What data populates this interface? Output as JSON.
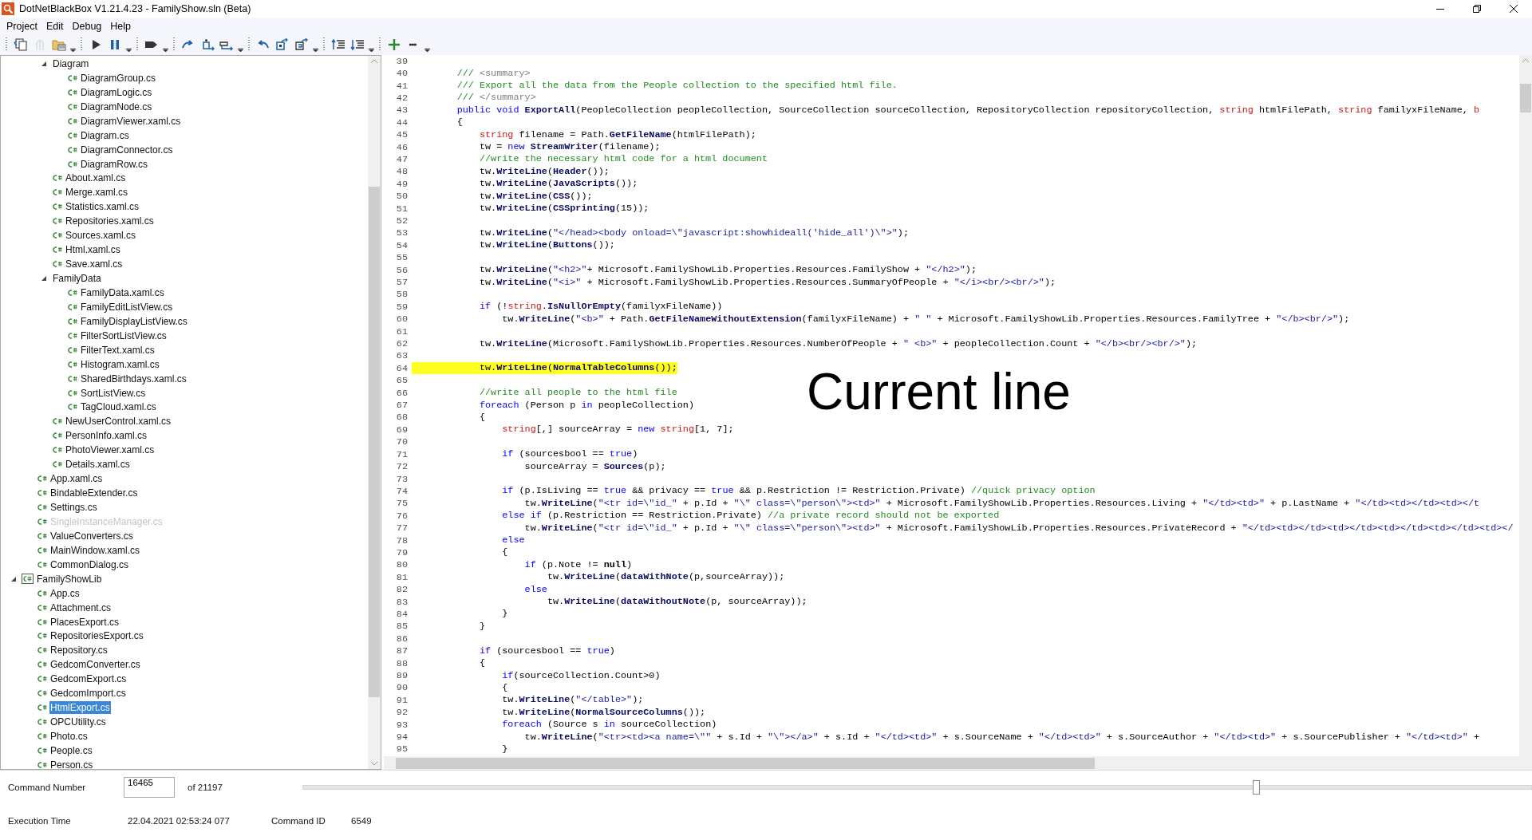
{
  "window": {
    "title": "DotNetBlackBox V1.21.4.23 - FamilyShow.sln (Beta)"
  },
  "menu": [
    "Project",
    "Edit",
    "Debug",
    "Help"
  ],
  "tree": {
    "items": [
      {
        "children": [
          {
            "children": [
              {
                "kind": "folder",
                "label": "Diagram",
                "expanded": true,
                "children": [
                  {
                    "kind": "file",
                    "label": "DiagramGroup.cs",
                    "disabled": false,
                    "selected": false
                  },
                  {
                    "kind": "file",
                    "label": "DiagramLogic.cs",
                    "disabled": false,
                    "selected": false
                  },
                  {
                    "kind": "file",
                    "label": "DiagramNode.cs",
                    "disabled": false,
                    "selected": false
                  },
                  {
                    "kind": "file",
                    "label": "DiagramViewer.xaml.cs",
                    "disabled": false,
                    "selected": false
                  },
                  {
                    "kind": "file",
                    "label": "Diagram.cs",
                    "disabled": false,
                    "selected": false
                  },
                  {
                    "kind": "file",
                    "label": "DiagramConnector.cs",
                    "disabled": false,
                    "selected": false
                  },
                  {
                    "kind": "file",
                    "label": "DiagramRow.cs",
                    "disabled": false,
                    "selected": false
                  }
                ]
              },
              {
                "kind": "file",
                "label": "About.xaml.cs",
                "disabled": false,
                "selected": false
              },
              {
                "kind": "file",
                "label": "Merge.xaml.cs",
                "disabled": false,
                "selected": false
              },
              {
                "kind": "file",
                "label": "Statistics.xaml.cs",
                "disabled": false,
                "selected": false
              },
              {
                "kind": "file",
                "label": "Repositories.xaml.cs",
                "disabled": false,
                "selected": false
              },
              {
                "kind": "file",
                "label": "Sources.xaml.cs",
                "disabled": false,
                "selected": false
              },
              {
                "kind": "file",
                "label": "Html.xaml.cs",
                "disabled": false,
                "selected": false
              },
              {
                "kind": "file",
                "label": "Save.xaml.cs",
                "disabled": false,
                "selected": false
              },
              {
                "kind": "folder",
                "label": "FamilyData",
                "expanded": true,
                "children": [
                  {
                    "kind": "file",
                    "label": "FamilyData.xaml.cs",
                    "disabled": false,
                    "selected": false
                  },
                  {
                    "kind": "file",
                    "label": "FamilyEditListView.cs",
                    "disabled": false,
                    "selected": false
                  },
                  {
                    "kind": "file",
                    "label": "FamilyDisplayListView.cs",
                    "disabled": false,
                    "selected": false
                  },
                  {
                    "kind": "file",
                    "label": "FilterSortListView.cs",
                    "disabled": false,
                    "selected": false
                  },
                  {
                    "kind": "file",
                    "label": "FilterText.xaml.cs",
                    "disabled": false,
                    "selected": false
                  },
                  {
                    "kind": "file",
                    "label": "Histogram.xaml.cs",
                    "disabled": false,
                    "selected": false
                  },
                  {
                    "kind": "file",
                    "label": "SharedBirthdays.xaml.cs",
                    "disabled": false,
                    "selected": false
                  },
                  {
                    "kind": "file",
                    "label": "SortListView.cs",
                    "disabled": false,
                    "selected": false
                  },
                  {
                    "kind": "file",
                    "label": "TagCloud.xaml.cs",
                    "disabled": false,
                    "selected": false
                  }
                ]
              },
              {
                "kind": "file",
                "label": "NewUserControl.xaml.cs",
                "disabled": false,
                "selected": false
              },
              {
                "kind": "file",
                "label": "PersonInfo.xaml.cs",
                "disabled": false,
                "selected": false
              },
              {
                "kind": "file",
                "label": "PhotoViewer.xaml.cs",
                "disabled": false,
                "selected": false
              },
              {
                "kind": "file",
                "label": "Details.xaml.cs",
                "disabled": false,
                "selected": false
              }
            ]
          },
          {
            "kind": "file",
            "label": "App.xaml.cs",
            "disabled": false,
            "selected": false
          },
          {
            "kind": "file",
            "label": "BindableExtender.cs",
            "disabled": false,
            "selected": false
          },
          {
            "kind": "file",
            "label": "Settings.cs",
            "disabled": false,
            "selected": false
          },
          {
            "kind": "file",
            "label": "SingleInstanceManager.cs",
            "disabled": true,
            "selected": false
          },
          {
            "kind": "file",
            "label": "ValueConverters.cs",
            "disabled": false,
            "selected": false
          },
          {
            "kind": "file",
            "label": "MainWindow.xaml.cs",
            "disabled": false,
            "selected": false
          },
          {
            "kind": "file",
            "label": "CommonDialog.cs",
            "disabled": false,
            "selected": false
          }
        ]
      },
      {
        "kind": "project",
        "label": "FamilyShowLib",
        "expanded": true,
        "children": [
          {
            "kind": "file",
            "label": "App.cs",
            "disabled": false,
            "selected": false
          },
          {
            "kind": "file",
            "label": "Attachment.cs",
            "disabled": false,
            "selected": false
          },
          {
            "kind": "file",
            "label": "PlacesExport.cs",
            "disabled": false,
            "selected": false
          },
          {
            "kind": "file",
            "label": "RepositoriesExport.cs",
            "disabled": false,
            "selected": false
          },
          {
            "kind": "file",
            "label": "Repository.cs",
            "disabled": false,
            "selected": false
          },
          {
            "kind": "file",
            "label": "GedcomConverter.cs",
            "disabled": false,
            "selected": false
          },
          {
            "kind": "file",
            "label": "GedcomExport.cs",
            "disabled": false,
            "selected": false
          },
          {
            "kind": "file",
            "label": "GedcomImport.cs",
            "disabled": false,
            "selected": false
          },
          {
            "kind": "file",
            "label": "HtmlExport.cs",
            "disabled": false,
            "selected": true
          },
          {
            "kind": "file",
            "label": "OPCUtility.cs",
            "disabled": false,
            "selected": false
          },
          {
            "kind": "file",
            "label": "Photo.cs",
            "disabled": false,
            "selected": false
          },
          {
            "kind": "file",
            "label": "People.cs",
            "disabled": false,
            "selected": false
          },
          {
            "kind": "file",
            "label": "Person.cs",
            "disabled": false,
            "selected": false
          }
        ]
      }
    ]
  },
  "editor": {
    "overlay_label": "Current line",
    "lines": [
      {
        "number": "39",
        "current": false
      },
      {
        "number": "40",
        "current": false,
        "tokens": [
          {
            "kind": "c",
            "text": "        /// "
          },
          {
            "kind": "d",
            "text": "<summary>"
          }
        ]
      },
      {
        "number": "41",
        "current": false,
        "tokens": [
          {
            "kind": "c",
            "text": "        /// Export all the data from the People collection to the specified html file."
          }
        ]
      },
      {
        "number": "42",
        "current": false,
        "tokens": [
          {
            "kind": "c",
            "text": "        /// "
          },
          {
            "kind": "d",
            "text": "</summary>"
          }
        ]
      },
      {
        "number": "43",
        "current": false,
        "tokens": [
          {
            "kind": "k",
            "text": "        public void "
          },
          {
            "kind": "f",
            "text": "ExportAll"
          },
          {
            "kind": "p",
            "text": "(PeopleCollection peopleCollection, SourceCollection sourceCollection, RepositoryCollection repositoryCollection, "
          },
          {
            "kind": "t",
            "text": "string"
          },
          {
            "kind": "p",
            "text": " htmlFilePath, "
          },
          {
            "kind": "t",
            "text": "string"
          },
          {
            "kind": "p",
            "text": " familyxFileName, "
          },
          {
            "kind": "t",
            "text": "b"
          }
        ]
      },
      {
        "number": "44",
        "current": false,
        "tokens": [
          {
            "kind": "p",
            "text": "        {"
          }
        ]
      },
      {
        "number": "45",
        "current": false,
        "tokens": [
          {
            "kind": "t",
            "text": "            string"
          },
          {
            "kind": "p",
            "text": " filename = Path."
          },
          {
            "kind": "f",
            "text": "GetFileName"
          },
          {
            "kind": "p",
            "text": "(htmlFilePath);"
          }
        ]
      },
      {
        "number": "46",
        "current": false,
        "tokens": [
          {
            "kind": "p",
            "text": "            tw = "
          },
          {
            "kind": "k",
            "text": "new "
          },
          {
            "kind": "f",
            "text": "StreamWriter"
          },
          {
            "kind": "p",
            "text": "(filename);"
          }
        ]
      },
      {
        "number": "47",
        "current": false,
        "tokens": [
          {
            "kind": "c",
            "text": "            //write the necessary html code for a html document"
          }
        ]
      },
      {
        "number": "48",
        "current": false,
        "tokens": [
          {
            "kind": "p",
            "text": "            tw."
          },
          {
            "kind": "f",
            "text": "WriteLine"
          },
          {
            "kind": "p",
            "text": "("
          },
          {
            "kind": "f",
            "text": "Header"
          },
          {
            "kind": "p",
            "text": "());"
          }
        ]
      },
      {
        "number": "49",
        "current": false,
        "tokens": [
          {
            "kind": "p",
            "text": "            tw."
          },
          {
            "kind": "f",
            "text": "WriteLine"
          },
          {
            "kind": "p",
            "text": "("
          },
          {
            "kind": "f",
            "text": "JavaScripts"
          },
          {
            "kind": "p",
            "text": "());"
          }
        ]
      },
      {
        "number": "50",
        "current": false,
        "tokens": [
          {
            "kind": "p",
            "text": "            tw."
          },
          {
            "kind": "f",
            "text": "WriteLine"
          },
          {
            "kind": "p",
            "text": "("
          },
          {
            "kind": "f",
            "text": "CSS"
          },
          {
            "kind": "p",
            "text": "());"
          }
        ]
      },
      {
        "number": "51",
        "current": false,
        "tokens": [
          {
            "kind": "p",
            "text": "            tw."
          },
          {
            "kind": "f",
            "text": "WriteLine"
          },
          {
            "kind": "p",
            "text": "("
          },
          {
            "kind": "f",
            "text": "CSSprinting"
          },
          {
            "kind": "p",
            "text": "(15));"
          }
        ]
      },
      {
        "number": "52",
        "current": false
      },
      {
        "number": "53",
        "current": false,
        "tokens": [
          {
            "kind": "p",
            "text": "            tw."
          },
          {
            "kind": "f",
            "text": "WriteLine"
          },
          {
            "kind": "p",
            "text": "("
          },
          {
            "kind": "s",
            "text": "\"</head><body onload=\\\"javascript:showhideall('hide_all')\\\">\""
          },
          {
            "kind": "p",
            "text": ");"
          }
        ]
      },
      {
        "number": "54",
        "current": false,
        "tokens": [
          {
            "kind": "p",
            "text": "            tw."
          },
          {
            "kind": "f",
            "text": "WriteLine"
          },
          {
            "kind": "p",
            "text": "("
          },
          {
            "kind": "f",
            "text": "Buttons"
          },
          {
            "kind": "p",
            "text": "());"
          }
        ]
      },
      {
        "number": "55",
        "current": false
      },
      {
        "number": "56",
        "current": false,
        "tokens": [
          {
            "kind": "p",
            "text": "            tw."
          },
          {
            "kind": "f",
            "text": "WriteLine"
          },
          {
            "kind": "p",
            "text": "("
          },
          {
            "kind": "s",
            "text": "\"<h2>\""
          },
          {
            "kind": "p",
            "text": "+ Microsoft.FamilyShowLib.Properties.Resources.FamilyShow + "
          },
          {
            "kind": "s",
            "text": "\"</h2>\""
          },
          {
            "kind": "p",
            "text": ");"
          }
        ]
      },
      {
        "number": "57",
        "current": false,
        "tokens": [
          {
            "kind": "p",
            "text": "            tw."
          },
          {
            "kind": "f",
            "text": "WriteLine"
          },
          {
            "kind": "p",
            "text": "("
          },
          {
            "kind": "s",
            "text": "\"<i>\""
          },
          {
            "kind": "p",
            "text": " + Microsoft.FamilyShowLib.Properties.Resources.SummaryOfPeople + "
          },
          {
            "kind": "s",
            "text": "\"</i><br/><br/>\""
          },
          {
            "kind": "p",
            "text": ");"
          }
        ]
      },
      {
        "number": "58",
        "current": false
      },
      {
        "number": "59",
        "current": false,
        "tokens": [
          {
            "kind": "k",
            "text": "            if"
          },
          {
            "kind": "p",
            "text": " (!"
          },
          {
            "kind": "t",
            "text": "string"
          },
          {
            "kind": "p",
            "text": "."
          },
          {
            "kind": "f",
            "text": "IsNullOrEmpty"
          },
          {
            "kind": "p",
            "text": "(familyxFileName))"
          }
        ]
      },
      {
        "number": "60",
        "current": false,
        "tokens": [
          {
            "kind": "p",
            "text": "                tw."
          },
          {
            "kind": "f",
            "text": "WriteLine"
          },
          {
            "kind": "p",
            "text": "("
          },
          {
            "kind": "s",
            "text": "\"<b>\""
          },
          {
            "kind": "p",
            "text": " + Path."
          },
          {
            "kind": "f",
            "text": "GetFileNameWithoutExtension"
          },
          {
            "kind": "p",
            "text": "(familyxFileName) + "
          },
          {
            "kind": "s",
            "text": "\" \""
          },
          {
            "kind": "p",
            "text": " + Microsoft.FamilyShowLib.Properties.Resources.FamilyTree + "
          },
          {
            "kind": "s",
            "text": "\"</b><br/>\""
          },
          {
            "kind": "p",
            "text": ");"
          }
        ]
      },
      {
        "number": "61",
        "current": false
      },
      {
        "number": "62",
        "current": false,
        "tokens": [
          {
            "kind": "p",
            "text": "            tw."
          },
          {
            "kind": "f",
            "text": "WriteLine"
          },
          {
            "kind": "p",
            "text": "(Microsoft.FamilyShowLib.Properties.Resources.NumberOfPeople + "
          },
          {
            "kind": "s",
            "text": "\" <b>\""
          },
          {
            "kind": "p",
            "text": " + peopleCollection.Count + "
          },
          {
            "kind": "s",
            "text": "\"</b><br/><br/>\""
          },
          {
            "kind": "p",
            "text": ");"
          }
        ]
      },
      {
        "number": "63",
        "current": false
      },
      {
        "number": "64",
        "current": true,
        "tokens": [
          {
            "kind": "p",
            "text": "            tw."
          },
          {
            "kind": "f",
            "text": "WriteLine"
          },
          {
            "kind": "p",
            "text": "("
          },
          {
            "kind": "f",
            "text": "NormalTableColumns"
          },
          {
            "kind": "p",
            "text": "());"
          }
        ]
      },
      {
        "number": "65",
        "current": false
      },
      {
        "number": "66",
        "current": false,
        "tokens": [
          {
            "kind": "c",
            "text": "            //write all people to the html file"
          }
        ]
      },
      {
        "number": "67",
        "current": false,
        "tokens": [
          {
            "kind": "k",
            "text": "            foreach"
          },
          {
            "kind": "p",
            "text": " (Person p "
          },
          {
            "kind": "k",
            "text": "in"
          },
          {
            "kind": "p",
            "text": " peopleCollection)"
          }
        ]
      },
      {
        "number": "68",
        "current": false,
        "tokens": [
          {
            "kind": "p",
            "text": "            {"
          }
        ]
      },
      {
        "number": "69",
        "current": false,
        "tokens": [
          {
            "kind": "t",
            "text": "                string"
          },
          {
            "kind": "p",
            "text": "[,] sourceArray = "
          },
          {
            "kind": "k",
            "text": "new "
          },
          {
            "kind": "t",
            "text": "string"
          },
          {
            "kind": "p",
            "text": "[1, 7];"
          }
        ]
      },
      {
        "number": "70",
        "current": false
      },
      {
        "number": "71",
        "current": false,
        "tokens": [
          {
            "kind": "k",
            "text": "                if"
          },
          {
            "kind": "p",
            "text": " (sourcesbool == "
          },
          {
            "kind": "k",
            "text": "true"
          },
          {
            "kind": "p",
            "text": ")"
          }
        ]
      },
      {
        "number": "72",
        "current": false,
        "tokens": [
          {
            "kind": "p",
            "text": "                    sourceArray = "
          },
          {
            "kind": "f",
            "text": "Sources"
          },
          {
            "kind": "p",
            "text": "(p);"
          }
        ]
      },
      {
        "number": "73",
        "current": false
      },
      {
        "number": "74",
        "current": false,
        "tokens": [
          {
            "kind": "k",
            "text": "                if"
          },
          {
            "kind": "p",
            "text": " (p.IsLiving == "
          },
          {
            "kind": "k",
            "text": "true"
          },
          {
            "kind": "p",
            "text": " && privacy == "
          },
          {
            "kind": "k",
            "text": "true"
          },
          {
            "kind": "p",
            "text": " && p.Restriction != Restriction.Private) "
          },
          {
            "kind": "c",
            "text": "//quick privacy option"
          }
        ]
      },
      {
        "number": "75",
        "current": false,
        "tokens": [
          {
            "kind": "p",
            "text": "                    tw."
          },
          {
            "kind": "f",
            "text": "WriteLine"
          },
          {
            "kind": "p",
            "text": "("
          },
          {
            "kind": "s",
            "text": "\"<tr id=\\\"id_\""
          },
          {
            "kind": "p",
            "text": " + p.Id + "
          },
          {
            "kind": "s",
            "text": "\"\\\" class=\\\"person\\\"><td>\""
          },
          {
            "kind": "p",
            "text": " + Microsoft.FamilyShowLib.Properties.Resources.Living + "
          },
          {
            "kind": "s",
            "text": "\"</td><td>\""
          },
          {
            "kind": "p",
            "text": " + p.LastName + "
          },
          {
            "kind": "s",
            "text": "\"</td><td></td><td></t"
          }
        ]
      },
      {
        "number": "76",
        "current": false,
        "tokens": [
          {
            "kind": "k",
            "text": "                else if"
          },
          {
            "kind": "p",
            "text": " (p.Restriction == Restriction.Private) "
          },
          {
            "kind": "c",
            "text": "//a private record should not be exported"
          }
        ]
      },
      {
        "number": "77",
        "current": false,
        "tokens": [
          {
            "kind": "p",
            "text": "                    tw."
          },
          {
            "kind": "f",
            "text": "WriteLine"
          },
          {
            "kind": "p",
            "text": "("
          },
          {
            "kind": "s",
            "text": "\"<tr id=\\\"id_\""
          },
          {
            "kind": "p",
            "text": " + p.Id + "
          },
          {
            "kind": "s",
            "text": "\"\\\" class=\\\"person\\\"><td>\""
          },
          {
            "kind": "p",
            "text": " + Microsoft.FamilyShowLib.Properties.Resources.PrivateRecord + "
          },
          {
            "kind": "s",
            "text": "\"</td><td></td><td></td><td></td><td></td><td></"
          }
        ]
      },
      {
        "number": "78",
        "current": false,
        "tokens": [
          {
            "kind": "k",
            "text": "                else"
          }
        ]
      },
      {
        "number": "79",
        "current": false,
        "tokens": [
          {
            "kind": "p",
            "text": "                {"
          }
        ]
      },
      {
        "number": "80",
        "current": false,
        "tokens": [
          {
            "kind": "k",
            "text": "                    if"
          },
          {
            "kind": "p",
            "text": " (p.Note != "
          },
          {
            "kind": "b",
            "text": "null"
          },
          {
            "kind": "p",
            "text": ")"
          }
        ]
      },
      {
        "number": "81",
        "current": false,
        "tokens": [
          {
            "kind": "p",
            "text": "                        tw."
          },
          {
            "kind": "f",
            "text": "WriteLine"
          },
          {
            "kind": "p",
            "text": "("
          },
          {
            "kind": "f",
            "text": "dataWithNote"
          },
          {
            "kind": "p",
            "text": "(p,sourceArray));"
          }
        ]
      },
      {
        "number": "82",
        "current": false,
        "tokens": [
          {
            "kind": "k",
            "text": "                    else"
          }
        ]
      },
      {
        "number": "83",
        "current": false,
        "tokens": [
          {
            "kind": "p",
            "text": "                        tw."
          },
          {
            "kind": "f",
            "text": "WriteLine"
          },
          {
            "kind": "p",
            "text": "("
          },
          {
            "kind": "f",
            "text": "dataWithoutNote"
          },
          {
            "kind": "p",
            "text": "(p, sourceArray));"
          }
        ]
      },
      {
        "number": "84",
        "current": false,
        "tokens": [
          {
            "kind": "p",
            "text": "                }"
          }
        ]
      },
      {
        "number": "85",
        "current": false,
        "tokens": [
          {
            "kind": "p",
            "text": "            }"
          }
        ]
      },
      {
        "number": "86",
        "current": false
      },
      {
        "number": "87",
        "current": false,
        "tokens": [
          {
            "kind": "k",
            "text": "            if"
          },
          {
            "kind": "p",
            "text": " (sourcesbool == "
          },
          {
            "kind": "k",
            "text": "true"
          },
          {
            "kind": "p",
            "text": ")"
          }
        ]
      },
      {
        "number": "88",
        "current": false,
        "tokens": [
          {
            "kind": "p",
            "text": "            {"
          }
        ]
      },
      {
        "number": "89",
        "current": false,
        "tokens": [
          {
            "kind": "k",
            "text": "                if"
          },
          {
            "kind": "p",
            "text": "(sourceCollection.Count>0)"
          }
        ]
      },
      {
        "number": "90",
        "current": false,
        "tokens": [
          {
            "kind": "p",
            "text": "                {"
          }
        ]
      },
      {
        "number": "91",
        "current": false,
        "tokens": [
          {
            "kind": "p",
            "text": "                tw."
          },
          {
            "kind": "f",
            "text": "WriteLine"
          },
          {
            "kind": "p",
            "text": "("
          },
          {
            "kind": "s",
            "text": "\"</table>\""
          },
          {
            "kind": "p",
            "text": ");"
          }
        ]
      },
      {
        "number": "92",
        "current": false,
        "tokens": [
          {
            "kind": "p",
            "text": "                tw."
          },
          {
            "kind": "f",
            "text": "WriteLine"
          },
          {
            "kind": "p",
            "text": "("
          },
          {
            "kind": "f",
            "text": "NormalSourceColumns"
          },
          {
            "kind": "p",
            "text": "());"
          }
        ]
      },
      {
        "number": "93",
        "current": false,
        "tokens": [
          {
            "kind": "k",
            "text": "                foreach"
          },
          {
            "kind": "p",
            "text": " (Source s "
          },
          {
            "kind": "k",
            "text": "in"
          },
          {
            "kind": "p",
            "text": " sourceCollection)"
          }
        ]
      },
      {
        "number": "94",
        "current": false,
        "tokens": [
          {
            "kind": "p",
            "text": "                    tw."
          },
          {
            "kind": "f",
            "text": "WriteLine"
          },
          {
            "kind": "p",
            "text": "("
          },
          {
            "kind": "s",
            "text": "\"<tr><td><a name=\\\"\""
          },
          {
            "kind": "p",
            "text": " + s.Id + "
          },
          {
            "kind": "s",
            "text": "\"\\\"></a>\""
          },
          {
            "kind": "p",
            "text": " + s.Id + "
          },
          {
            "kind": "s",
            "text": "\"</td><td>\""
          },
          {
            "kind": "p",
            "text": " + s.SourceName + "
          },
          {
            "kind": "s",
            "text": "\"</td><td>\""
          },
          {
            "kind": "p",
            "text": " + s.SourceAuthor + "
          },
          {
            "kind": "s",
            "text": "\"</td><td>\""
          },
          {
            "kind": "p",
            "text": " + s.SourcePublisher + "
          },
          {
            "kind": "s",
            "text": "\"</td><td>\""
          },
          {
            "kind": "p",
            "text": " +"
          }
        ]
      },
      {
        "number": "95",
        "current": false,
        "tokens": [
          {
            "kind": "p",
            "text": "                }"
          }
        ]
      }
    ]
  },
  "status": {
    "command_number_label": "Command Number",
    "command_number": "16465",
    "command_total": "of 21197",
    "position": {
      "level": 0.776
    },
    "execution_time_label": "Execution Time",
    "execution_time": "22.04.2021 02:53:24 077",
    "command_id_label": "Command ID",
    "command_id": "6549"
  }
}
